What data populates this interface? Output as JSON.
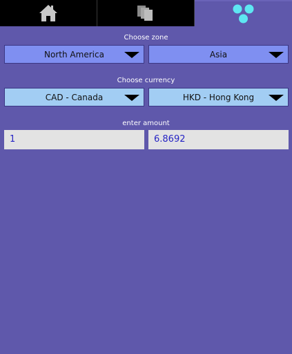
{
  "tabs": [
    {
      "icon": "home-icon"
    },
    {
      "icon": "stacked-pages-icon"
    },
    {
      "icon": "three-dots-icon",
      "selected": true
    }
  ],
  "zone": {
    "label": "Choose zone",
    "from": "North America",
    "to": "Asia"
  },
  "currency": {
    "label": "Choose currency",
    "from": "CAD - Canada",
    "to": "HKD - Hong Kong"
  },
  "amount": {
    "label": "enter amount",
    "from_value": "1",
    "to_value": "6.8692"
  },
  "colors": {
    "background": "#5f58ab",
    "tab_bar": "#000000",
    "zone_select": "#7f8ff1",
    "currency_select": "#a2cdf3",
    "input_bg": "#e3e3e3",
    "input_text": "#2523c4",
    "dots_icon": "#5ee7f2"
  }
}
